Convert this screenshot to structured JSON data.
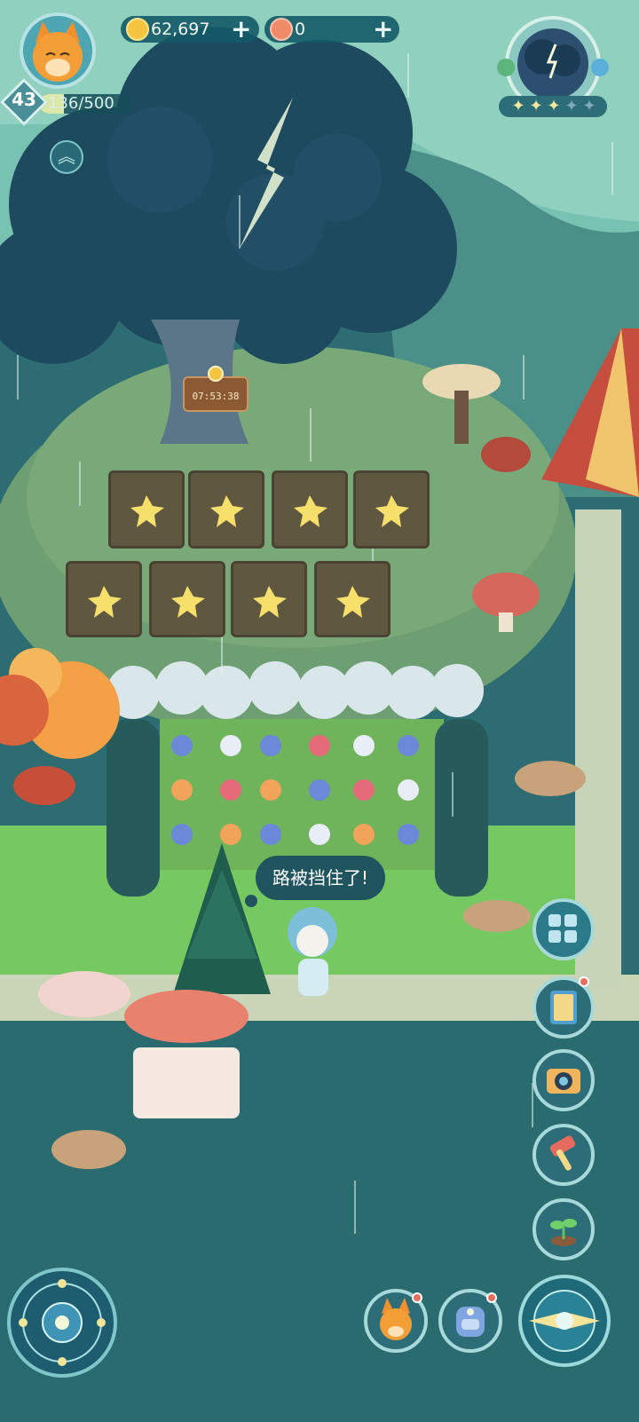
{
  "hud": {
    "level": "43",
    "xp": "136/500",
    "xp_progress": 0.272,
    "coins": "62,697",
    "gems": "0",
    "coin_plus": "+",
    "gem_plus": "+"
  },
  "weather_stars": {
    "filled": 3,
    "total": 5
  },
  "timer": "07:53:38",
  "speech": "路被挡住了!",
  "icons": [
    "avatar-fox-icon",
    "chevron-up-icon",
    "coin-icon",
    "gem-icon",
    "plus-icon",
    "weather-icon",
    "star-icon",
    "rune-compass-icon",
    "layout-editor-icon",
    "book-icon",
    "camera-icon",
    "hammer-icon",
    "sprout-icon",
    "fox-character-icon",
    "backpack-icon",
    "navigator-icon"
  ],
  "colors": {
    "accent": "#2c6d77",
    "coin": "#f5c542",
    "badge": "#e76e5f"
  }
}
